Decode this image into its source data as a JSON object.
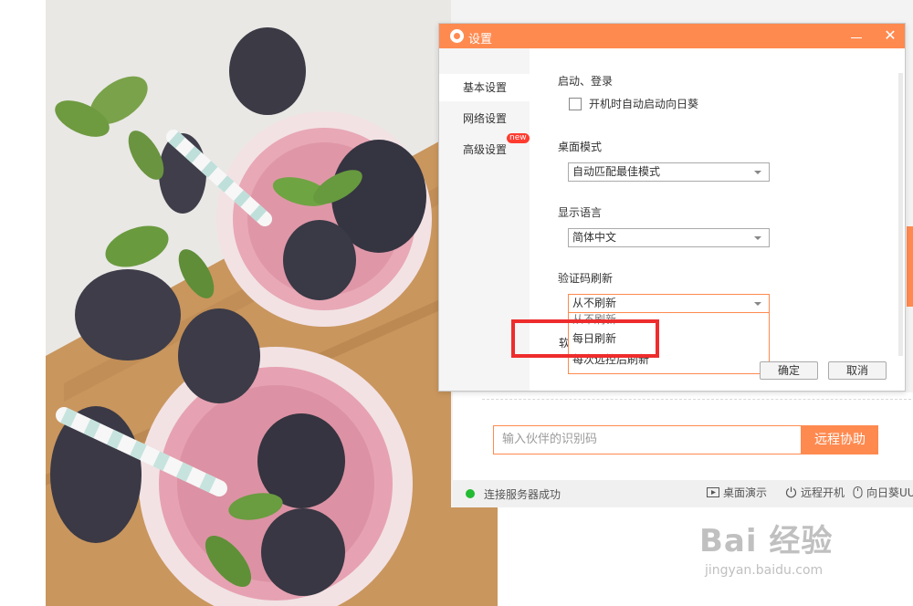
{
  "dialog": {
    "title": "设置",
    "nav": [
      {
        "label": "基本设置"
      },
      {
        "label": "网络设置"
      },
      {
        "label": "高级设置",
        "badge": "new"
      }
    ],
    "sections": {
      "startup": {
        "title": "启动、登录",
        "checkbox_label": "开机时自动启动向日葵",
        "checked": false
      },
      "desktop_mode": {
        "title": "桌面模式",
        "value": "自动匹配最佳模式"
      },
      "language": {
        "title": "显示语言",
        "value": "简体中文"
      },
      "captcha": {
        "title": "验证码刷新",
        "value": "从不刷新",
        "options": [
          "从不刷新",
          "每日刷新",
          "每次远控后刷新"
        ]
      },
      "partial_label": "软"
    },
    "ok_label": "确定",
    "cancel_label": "取消"
  },
  "main": {
    "id_placeholder": "输入伙伴的识别码",
    "remote_button": "远程协助",
    "status_text": "连接服务器成功",
    "status_color": "#22bb33",
    "bottom_items": [
      "桌面演示",
      "远程开机",
      "向日葵UU"
    ]
  },
  "colors": {
    "accent": "#ff8a50",
    "highlight": "#ee2c2c"
  },
  "watermark": {
    "main": "Bai 经验",
    "sub": "jingyan.baidu.com"
  }
}
